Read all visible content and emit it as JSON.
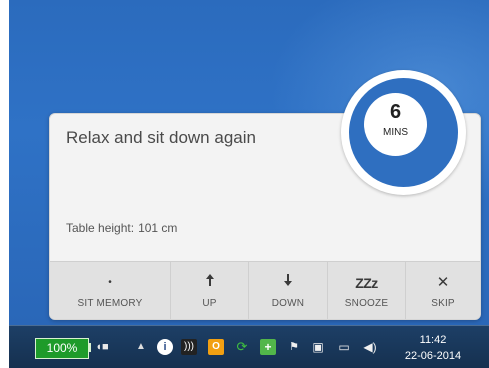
{
  "notification": {
    "message": "Relax and sit down again",
    "table_height_label": "Table height:",
    "table_height_value": "101 cm",
    "timer": {
      "value": "6",
      "unit": "MINS"
    },
    "actions": [
      {
        "id": "sit-memory",
        "icon": "•",
        "label": "SIT MEMORY"
      },
      {
        "id": "up",
        "icon": "🠕",
        "label": "UP"
      },
      {
        "id": "down",
        "icon": "🠗",
        "label": "DOWN"
      },
      {
        "id": "snooze",
        "icon": "ZZz",
        "label": "SNOOZE"
      },
      {
        "id": "skip",
        "icon": "✕",
        "label": "SKIP"
      }
    ]
  },
  "taskbar": {
    "battery": "100%",
    "tray_icons": [
      "plug-icon",
      "show-hidden-arrow-icon",
      "info-icon",
      "wireless-icon",
      "office-icon",
      "sync-icon",
      "plus-icon",
      "flag-icon",
      "device-icon",
      "network-icon",
      "volume-icon"
    ],
    "time": "11:42",
    "date": "22-06-2014"
  },
  "colors": {
    "accent": "#2f6fc0",
    "desktop": "#2b6bbd",
    "battery": "#1e9b2a",
    "taskbar": "#1d3f66"
  }
}
